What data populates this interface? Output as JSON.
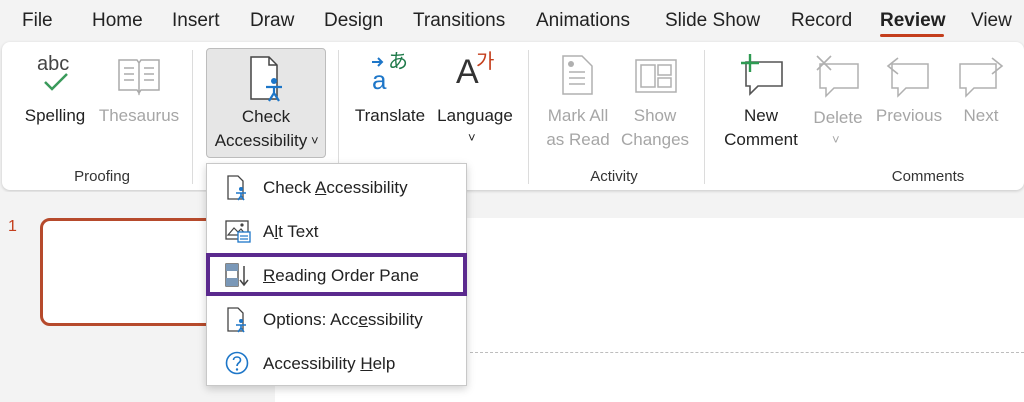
{
  "menubar": {
    "tabs": [
      "File",
      "Home",
      "Insert",
      "Draw",
      "Design",
      "Transitions",
      "Animations",
      "Slide Show",
      "Record",
      "Review",
      "View"
    ],
    "active": "Review",
    "accent_color": "#c43e1c"
  },
  "ribbon": {
    "abc_glyph": "abc",
    "spelling": "Spelling",
    "thesaurus": "Thesaurus",
    "check_line1": "Check",
    "check_line2": "Accessibility",
    "chevron": "˅",
    "translate": "Translate",
    "language": "Language",
    "translate_glyph_a": "a",
    "translate_glyph_jp": "あ",
    "language_glyph_a": "A",
    "language_glyph_kr": "가",
    "mark_line1": "Mark All",
    "mark_line2": "as Read",
    "show_line1": "Show",
    "show_line2": "Changes",
    "new_line1": "New",
    "new_line2": "Comment",
    "delete": "Delete",
    "previous": "Previous",
    "next": "Next",
    "groups": {
      "proofing": "Proofing",
      "activity": "Activity",
      "comments": "Comments"
    }
  },
  "slides": {
    "number": "1"
  },
  "dropdown": {
    "items": [
      {
        "pre": "Check ",
        "key": "A",
        "post": "ccessibility",
        "icon": "accessibility-checker-icon"
      },
      {
        "pre": "A",
        "key": "l",
        "post": "t Text",
        "icon": "alt-text-icon"
      },
      {
        "pre": "",
        "key": "R",
        "post": "eading Order Pane",
        "icon": "reading-order-icon"
      },
      {
        "pre": "Options: Acc",
        "key": "e",
        "post": "ssibility",
        "icon": "accessibility-options-icon"
      },
      {
        "pre": "Accessibility ",
        "key": "H",
        "post": "elp",
        "icon": "help-icon"
      }
    ],
    "highlighted": "Reading Order Pane",
    "highlight_color": "#5b2a8e"
  }
}
